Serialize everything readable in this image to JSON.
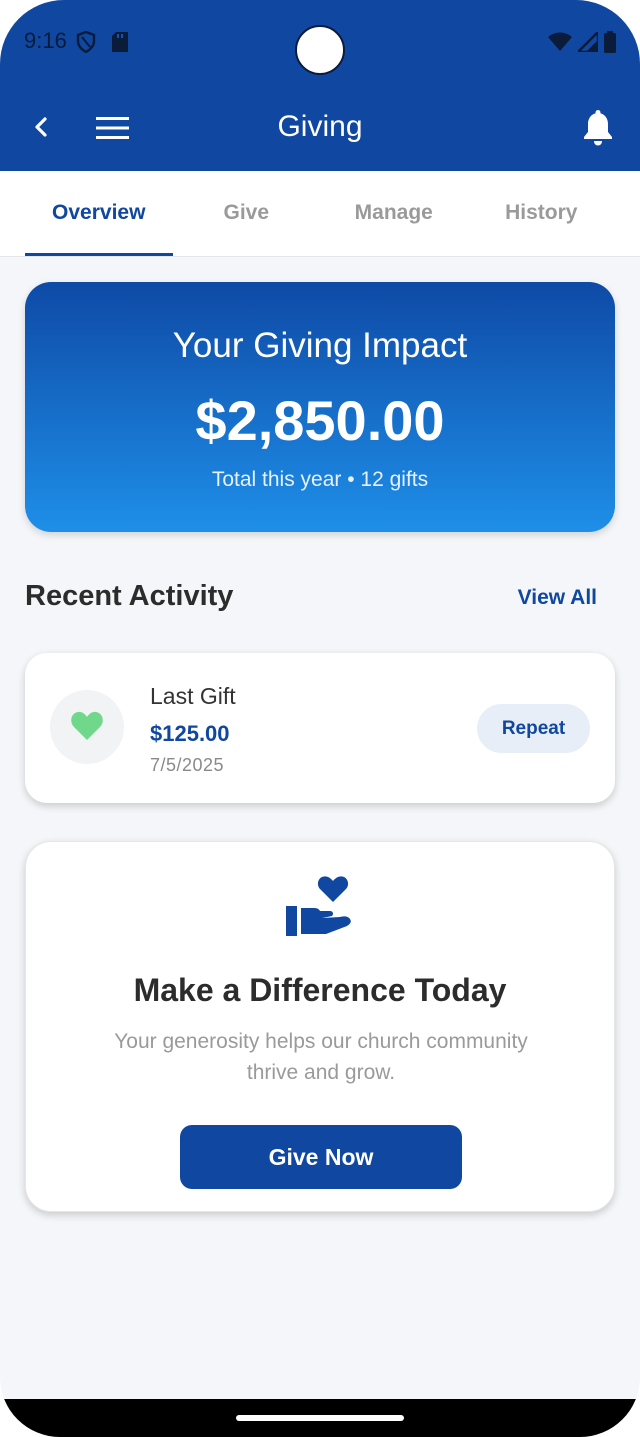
{
  "status_bar": {
    "time": "9:16",
    "icons": [
      "shield-icon",
      "sd-card-icon",
      "wifi-icon",
      "cellular-signal-icon",
      "battery-icon"
    ]
  },
  "app_bar": {
    "title": "Giving",
    "icons": [
      "back-arrow-icon",
      "menu-icon",
      "bell-icon"
    ]
  },
  "tabs": [
    {
      "label": "Overview",
      "active": true
    },
    {
      "label": "Give",
      "active": false
    },
    {
      "label": "Manage",
      "active": false
    },
    {
      "label": "History",
      "active": false
    }
  ],
  "impact": {
    "title": "Your Giving Impact",
    "amount": "$2,850.00",
    "subtitle": "Total this year • 12 gifts"
  },
  "recent_activity": {
    "title": "Recent Activity",
    "view_all": "View All",
    "gift": {
      "label": "Last Gift",
      "amount": "$125.00",
      "date": "7/5/2025",
      "action": "Repeat",
      "icon": "heart-icon"
    }
  },
  "cta": {
    "icon": "hand-heart-icon",
    "title": "Make a Difference Today",
    "text": "Your generosity helps our church community thrive and grow.",
    "button": "Give Now"
  },
  "colors": {
    "primary": "#0f47a1",
    "gradient_top": "#0e4aa6",
    "gradient_bottom": "#1e8fe8",
    "heart": "#6fd88a",
    "background": "#f5f6f9"
  }
}
